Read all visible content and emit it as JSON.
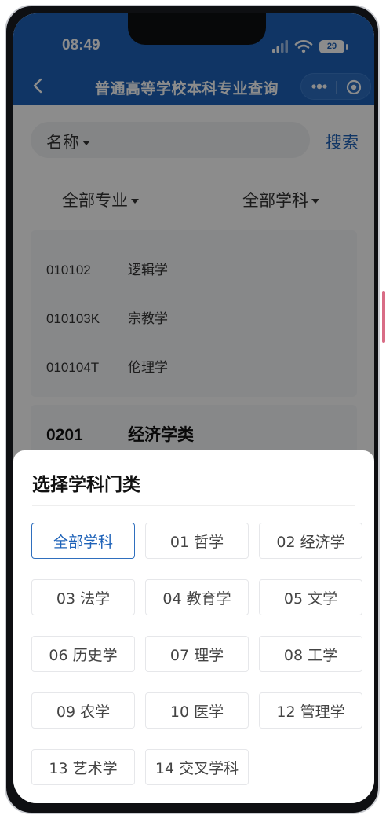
{
  "status_bar": {
    "time": "08:49",
    "battery": "29"
  },
  "nav": {
    "title": "普通高等学校本科专业查询"
  },
  "search": {
    "type_label": "名称",
    "button": "搜索"
  },
  "filters": {
    "major": "全部专业",
    "discipline": "全部学科"
  },
  "majors": [
    {
      "code": "010102",
      "name": "逻辑学"
    },
    {
      "code": "010103K",
      "name": "宗教学"
    },
    {
      "code": "010104T",
      "name": "伦理学"
    }
  ],
  "group": {
    "code": "0201",
    "name": "经济学类"
  },
  "sheet": {
    "title": "选择学科门类",
    "options": [
      "全部学科",
      "01 哲学",
      "02 经济学",
      "03 法学",
      "04 教育学",
      "05 文学",
      "06 历史学",
      "07 理学",
      "08 工学",
      "09 农学",
      "10 医学",
      "12 管理学",
      "13 艺术学",
      "14 交叉学科"
    ],
    "selected_index": 0
  },
  "colors": {
    "brand_blue": "#1e62b8",
    "mask": "rgba(0,0,0,0.45)"
  },
  "icons": {
    "back": "chevron-left-icon",
    "more": "more-dots-icon",
    "target": "target-icon",
    "signal": "signal-icon",
    "wifi": "wifi-icon"
  }
}
